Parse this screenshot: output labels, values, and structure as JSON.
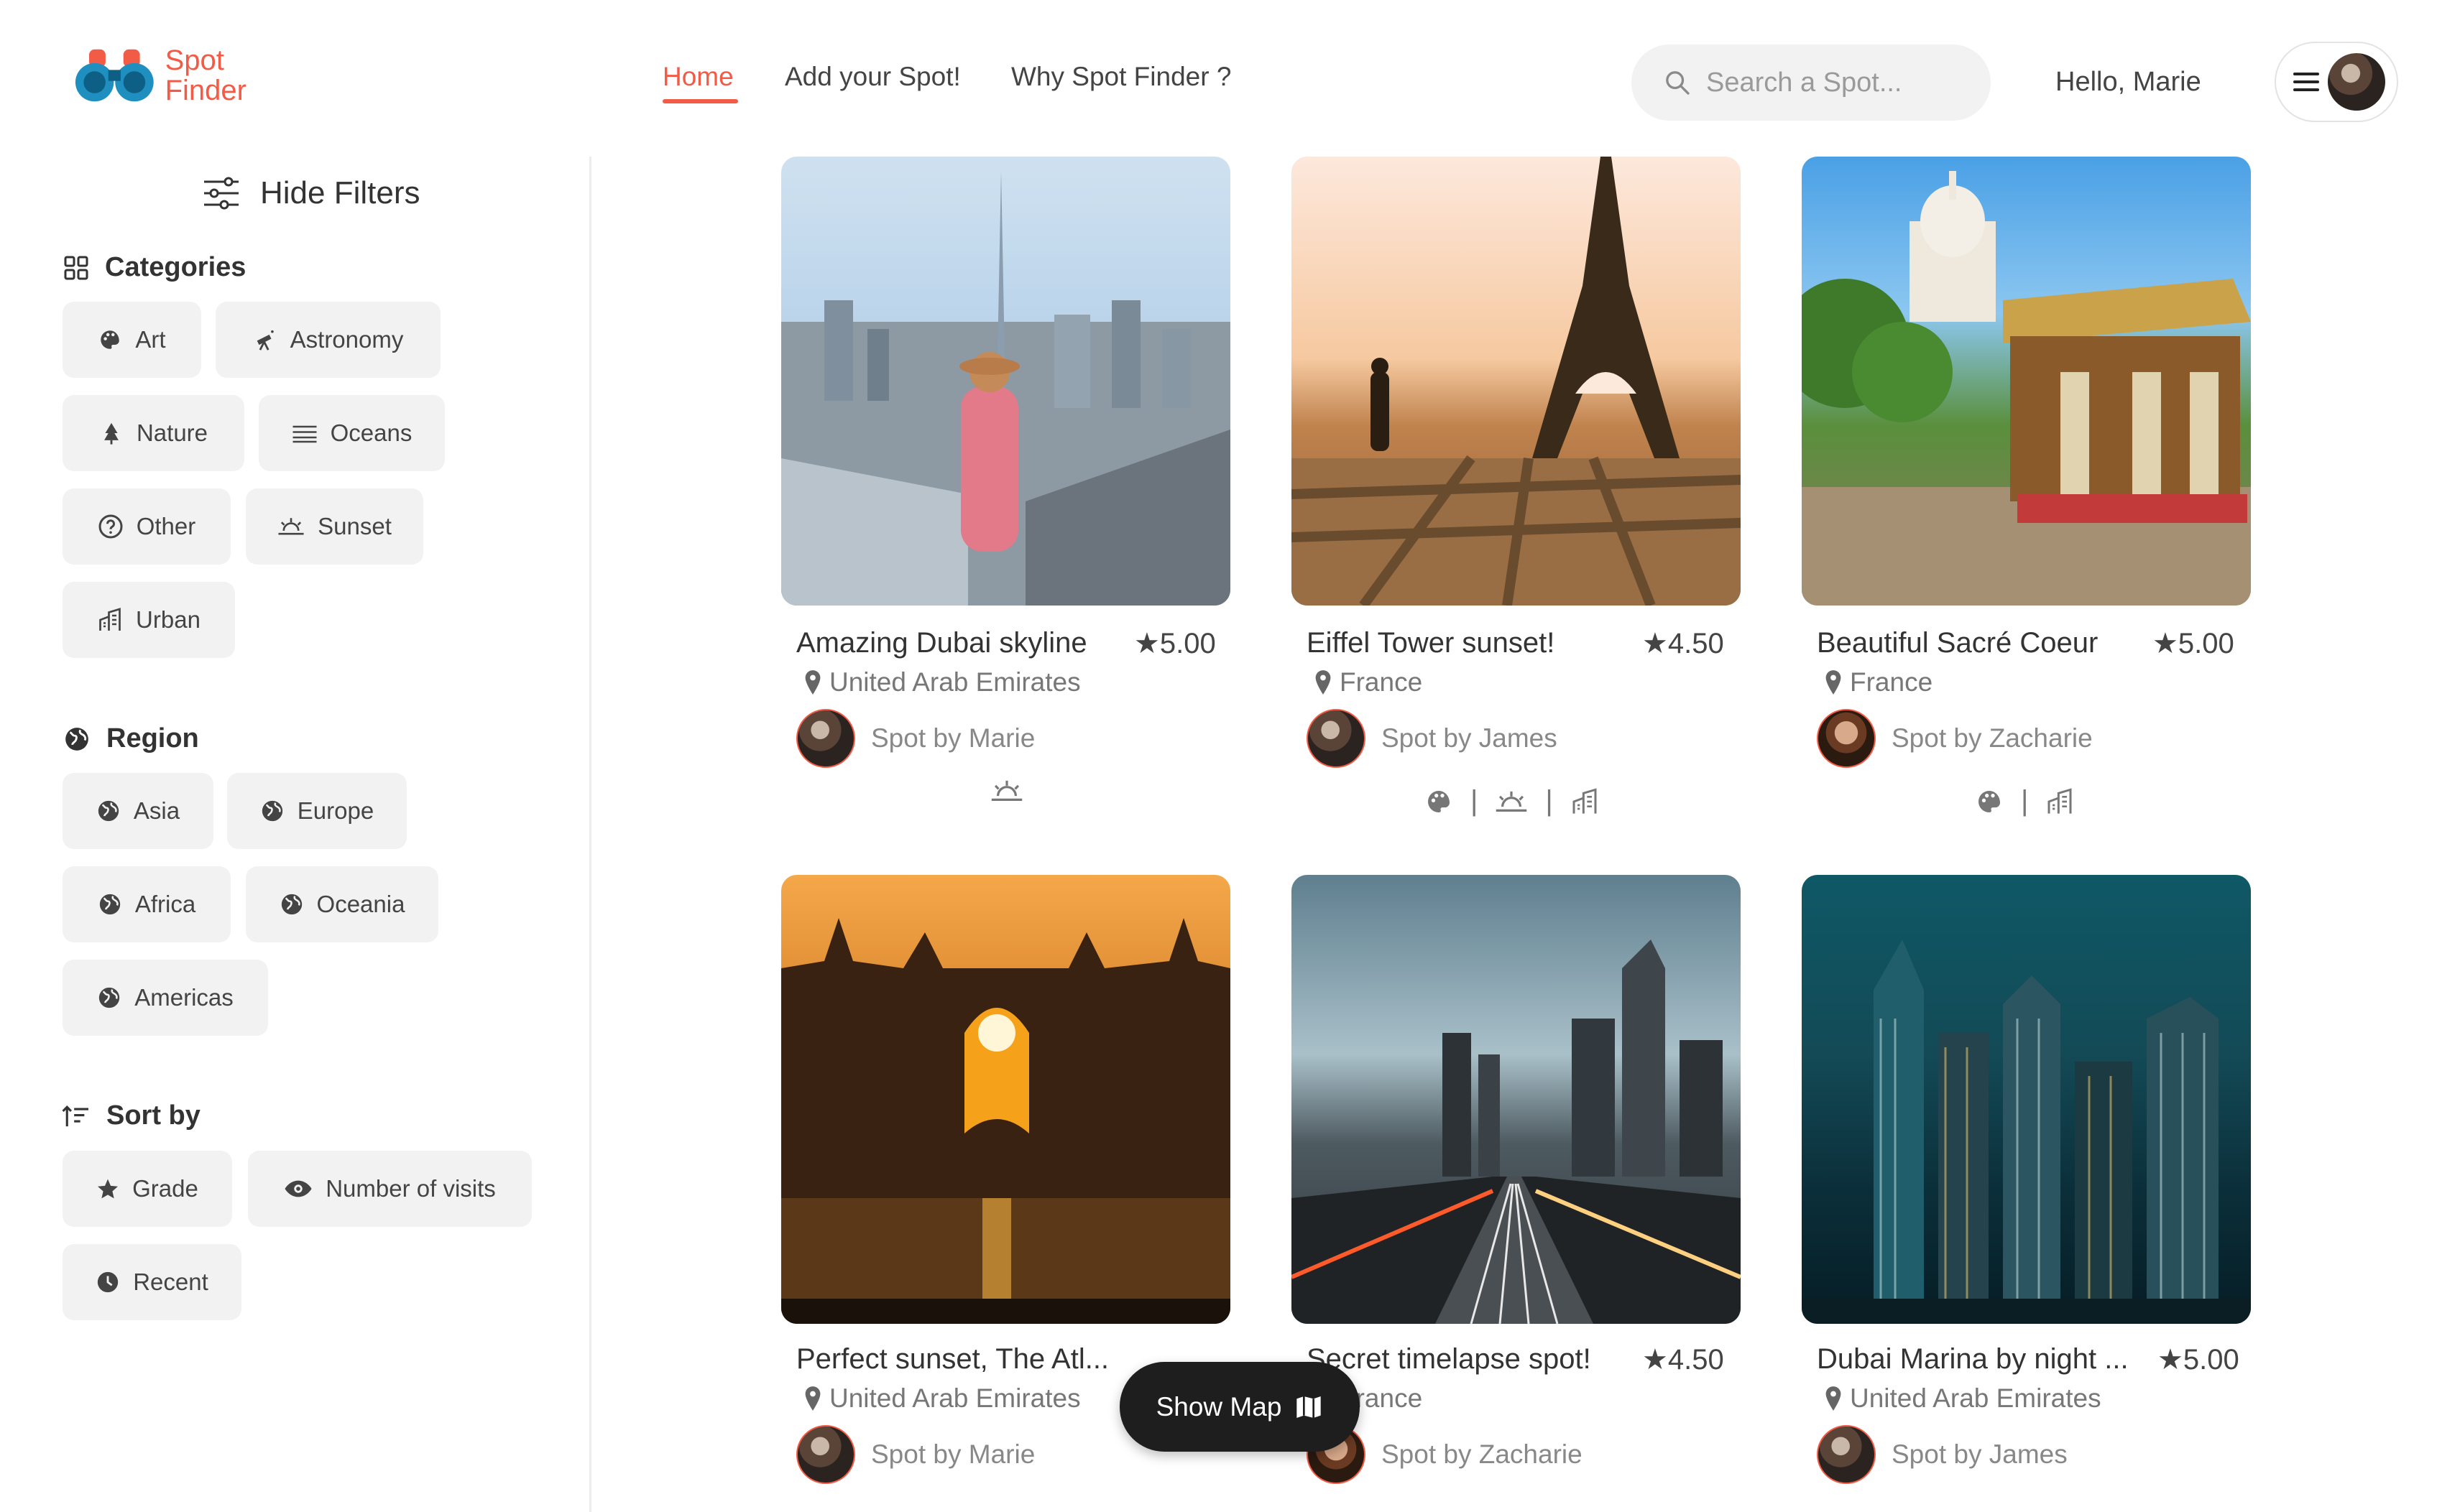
{
  "header": {
    "logo": {
      "line1": "Spot",
      "line2": "Finder",
      "icon": "binoculars-icon"
    },
    "nav": [
      {
        "label": "Home",
        "active": true
      },
      {
        "label": "Add your Spot!",
        "active": false
      },
      {
        "label": "Why Spot Finder ?",
        "active": false
      }
    ],
    "search": {
      "placeholder": "Search a Spot...",
      "icon": "search-icon"
    },
    "greeting": "Hello, Marie",
    "menu_icon": "hamburger-icon"
  },
  "sidebar": {
    "hide_filters": "Hide Filters",
    "categories": {
      "title": "Categories",
      "items": [
        "Art",
        "Astronomy",
        "Nature",
        "Oceans",
        "Other",
        "Sunset",
        "Urban"
      ]
    },
    "region": {
      "title": "Region",
      "items": [
        "Asia",
        "Europe",
        "Africa",
        "Oceania",
        "Americas"
      ]
    },
    "sort": {
      "title": "Sort by",
      "items": [
        "Grade",
        "Number of visits",
        "Recent"
      ]
    }
  },
  "spots": [
    {
      "title": "Amazing Dubai skyline",
      "rating": "5.00",
      "location": "United Arab Emirates",
      "author": "Spot by Marie",
      "tags": [
        "sunset"
      ]
    },
    {
      "title": "Eiffel Tower sunset!",
      "rating": "4.50",
      "location": "France",
      "author": "Spot by James",
      "tags": [
        "art",
        "sunset",
        "urban"
      ]
    },
    {
      "title": "Beautiful Sacré Coeur",
      "rating": "5.00",
      "location": "France",
      "author": "Spot by Zacharie",
      "tags": [
        "art",
        "urban"
      ]
    },
    {
      "title": "Perfect sunset, The Atl...",
      "rating": "",
      "location": "United Arab Emirates",
      "author": "Spot by Marie",
      "tags": []
    },
    {
      "title": "Secret timelapse spot!",
      "rating": "4.50",
      "location": "France",
      "author": "Spot by Zacharie",
      "tags": []
    },
    {
      "title": "Dubai Marina by night ...",
      "rating": "5.00",
      "location": "United Arab Emirates",
      "author": "Spot by James",
      "tags": []
    }
  ],
  "show_map": {
    "label": "Show Map",
    "icon": "map-icon"
  },
  "colors": {
    "accent": "#f25b45",
    "logo_blue": "#1f8fbf",
    "chip_bg": "#f2f2f2",
    "dark_button": "#1e1e1e"
  }
}
